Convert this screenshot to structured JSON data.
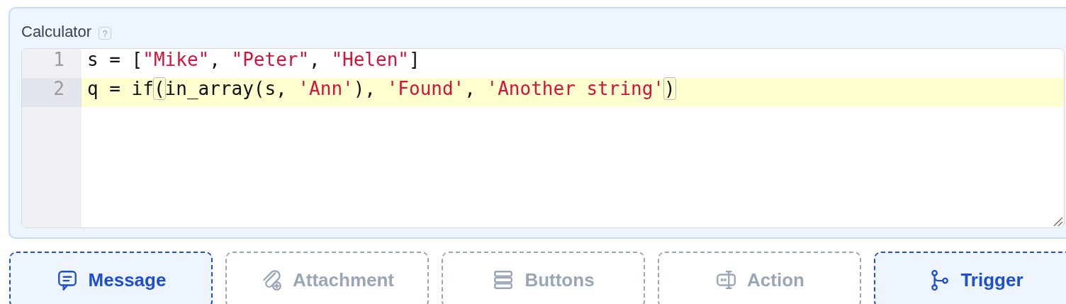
{
  "calculator": {
    "label": "Calculator",
    "help": "?",
    "editor": {
      "lines": [
        {
          "number": "1",
          "active": false,
          "tokens": [
            {
              "text": "s = [",
              "kind": "plain"
            },
            {
              "text": "\"Mike\"",
              "kind": "string"
            },
            {
              "text": ", ",
              "kind": "plain"
            },
            {
              "text": "\"Peter\"",
              "kind": "string"
            },
            {
              "text": ", ",
              "kind": "plain"
            },
            {
              "text": "\"Helen\"",
              "kind": "string"
            },
            {
              "text": "]",
              "kind": "plain"
            }
          ]
        },
        {
          "number": "2",
          "active": true,
          "tokens": [
            {
              "text": "q = if",
              "kind": "plain"
            },
            {
              "text": "(",
              "kind": "bracket-match"
            },
            {
              "text": "in_array(s, ",
              "kind": "plain"
            },
            {
              "text": "'Ann'",
              "kind": "string"
            },
            {
              "text": "), ",
              "kind": "plain"
            },
            {
              "text": "'Found'",
              "kind": "string"
            },
            {
              "text": ", ",
              "kind": "plain"
            },
            {
              "text": "'Another string'",
              "kind": "string"
            },
            {
              "text": ")",
              "kind": "bracket-match"
            }
          ]
        }
      ]
    }
  },
  "blocks": [
    {
      "label": "Message",
      "kind": "message",
      "selected": true
    },
    {
      "label": "Attachment",
      "kind": "attachment",
      "selected": false
    },
    {
      "label": "Buttons",
      "kind": "buttons",
      "selected": false
    },
    {
      "label": "Action",
      "kind": "action",
      "selected": false
    },
    {
      "label": "Trigger",
      "kind": "trigger",
      "selected": true
    }
  ]
}
